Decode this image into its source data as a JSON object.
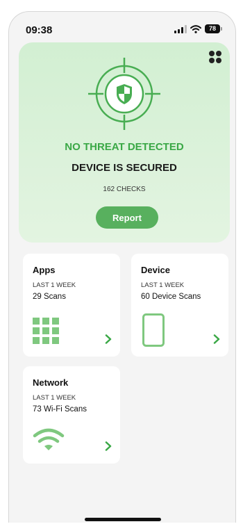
{
  "status_bar": {
    "time": "09:38",
    "battery": "78"
  },
  "hero": {
    "threat_status": "NO THREAT DETECTED",
    "device_status": "DEVICE IS SECURED",
    "checks": "162 CHECKS",
    "report_label": "Report"
  },
  "cards": {
    "apps": {
      "title": "Apps",
      "period": "LAST 1 WEEK",
      "scans": "29 Scans",
      "icon": "app-grid-icon"
    },
    "device": {
      "title": "Device",
      "period": "LAST 1 WEEK",
      "scans": "60 Device Scans",
      "icon": "phone-icon"
    },
    "network": {
      "title": "Network",
      "period": "LAST 1 WEEK",
      "scans": "73 Wi-Fi Scans",
      "icon": "wifi-icon"
    }
  },
  "colors": {
    "accent_green": "#58b05e",
    "status_green": "#3aa846",
    "hero_bg": "#d2efd2",
    "icon_green": "#7fc87f"
  }
}
